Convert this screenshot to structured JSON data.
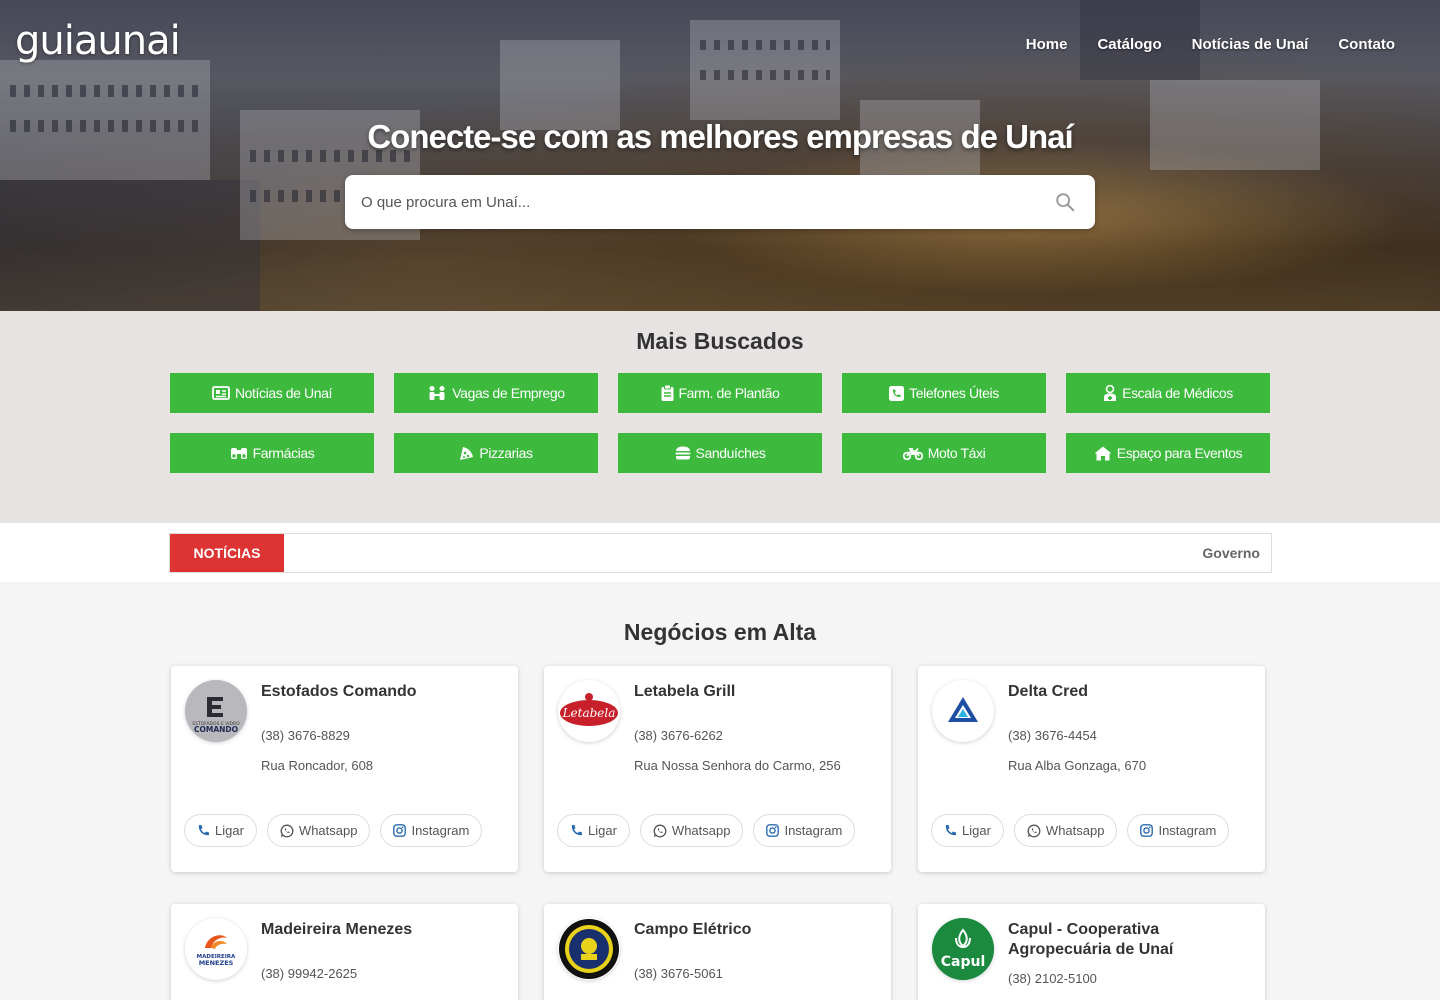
{
  "header": {
    "logo": "guiaunai",
    "nav": [
      "Home",
      "Catálogo",
      "Notícias de Unaí",
      "Contato"
    ]
  },
  "hero": {
    "title": "Conecte-se com as melhores empresas de Unaí",
    "search_placeholder": "O que procura em Unaí..."
  },
  "popular": {
    "title": "Mais Buscados",
    "buttons": [
      {
        "label": "Notícias de Unaí",
        "icon": "newspaper-icon"
      },
      {
        "label": "Vagas de Emprego",
        "icon": "people-icon"
      },
      {
        "label": "Farm. de Plantão",
        "icon": "clipboard-icon"
      },
      {
        "label": "Telefones Úteis",
        "icon": "phone-square-icon"
      },
      {
        "label": "Escala de Médicos",
        "icon": "doctor-icon"
      },
      {
        "label": "Farmácias",
        "icon": "binoculars-icon"
      },
      {
        "label": "Pizzarias",
        "icon": "pizza-icon"
      },
      {
        "label": "Sanduíches",
        "icon": "burger-icon"
      },
      {
        "label": "Moto Táxi",
        "icon": "motorcycle-icon"
      },
      {
        "label": "Espaço para Eventos",
        "icon": "house-icon"
      }
    ],
    "accent": "#3dba3d"
  },
  "news": {
    "tag": "NOTÍCIAS",
    "text": "Governo",
    "tag_color": "#dd3333"
  },
  "business": {
    "title": "Negócios em Alta",
    "action_labels": {
      "call": "Ligar",
      "whatsapp": "Whatsapp",
      "instagram": "Instagram"
    },
    "cards": [
      {
        "name": "Estofados Comando",
        "phone": "(38) 3676-8829",
        "address": "Rua Roncador, 608",
        "logo": "estofados-comando-logo",
        "logo_text_1": "ESTOFADOS E VIDRO",
        "logo_text_2": "COMANDO"
      },
      {
        "name": "Letabela Grill",
        "phone": "(38) 3676-6262",
        "address": "Rua Nossa Senhora do Carmo, 256",
        "logo": "letabela-logo",
        "logo_text_1": "Letabela",
        "logo_text_2": ""
      },
      {
        "name": "Delta Cred",
        "phone": "(38) 3676-4454",
        "address": "Rua Alba Gonzaga, 670",
        "logo": "delta-cred-logo",
        "logo_text_1": "",
        "logo_text_2": ""
      },
      {
        "name": "Madeireira Menezes",
        "phone": "(38) 99942-2625",
        "address": "",
        "logo": "madeireira-menezes-logo",
        "logo_text_1": "MADEIREIRA",
        "logo_text_2": "MENEZES"
      },
      {
        "name": "Campo Elétrico",
        "phone": "(38) 3676-5061",
        "address": "",
        "logo": "campo-eletrico-logo",
        "logo_text_1": "",
        "logo_text_2": ""
      },
      {
        "name": "Capul - Cooperativa Agropecuária de Unaí",
        "phone": "(38) 2102-5100",
        "address": "",
        "logo": "capul-logo",
        "logo_text_1": "Capul",
        "logo_text_2": ""
      }
    ]
  }
}
